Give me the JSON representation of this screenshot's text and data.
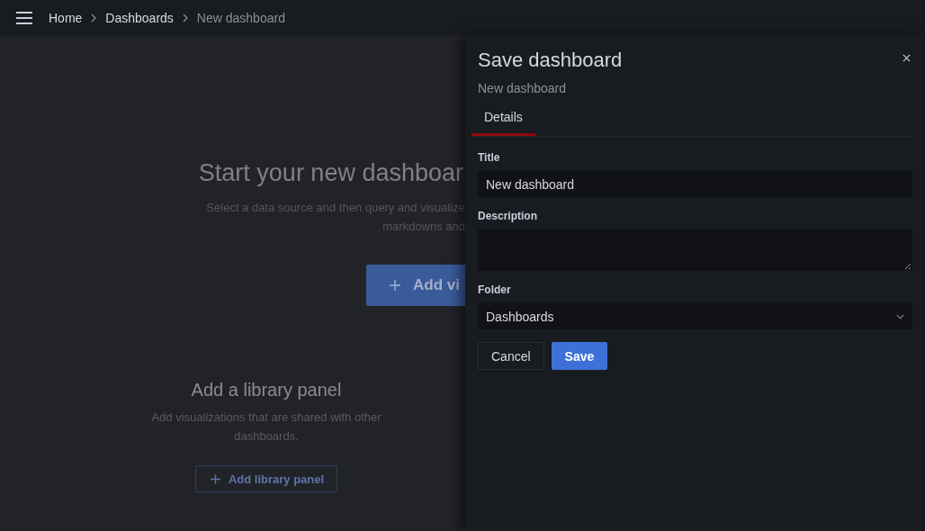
{
  "top_bar": {
    "breadcrumbs": [
      {
        "label": "Home",
        "current": false
      },
      {
        "label": "Dashboards",
        "current": false
      },
      {
        "label": "New dashboard",
        "current": true
      }
    ]
  },
  "background": {
    "heading": "Start your new dashboar",
    "text_lines": [
      "Select a data source and then query and visualize",
      "markdowns and"
    ],
    "add_button": "Add vi",
    "library": {
      "heading": "Add a library panel",
      "text": "Add visualizations that are shared with other dashboards.",
      "button": "Add library panel"
    }
  },
  "drawer": {
    "title": "Save dashboard",
    "subtitle": "New dashboard",
    "tabs": [
      {
        "label": "Details",
        "selected": true
      }
    ],
    "fields": [
      {
        "kind": "input",
        "label": "Title",
        "value": "New dashboard"
      },
      {
        "kind": "textarea",
        "label": "Description"
      },
      {
        "kind": "select",
        "label": "Folder",
        "value": "Dashboards"
      }
    ],
    "buttons": [
      {
        "kind": "secondary",
        "label": "Cancel"
      },
      {
        "kind": "primary",
        "label": "Save"
      }
    ]
  }
}
